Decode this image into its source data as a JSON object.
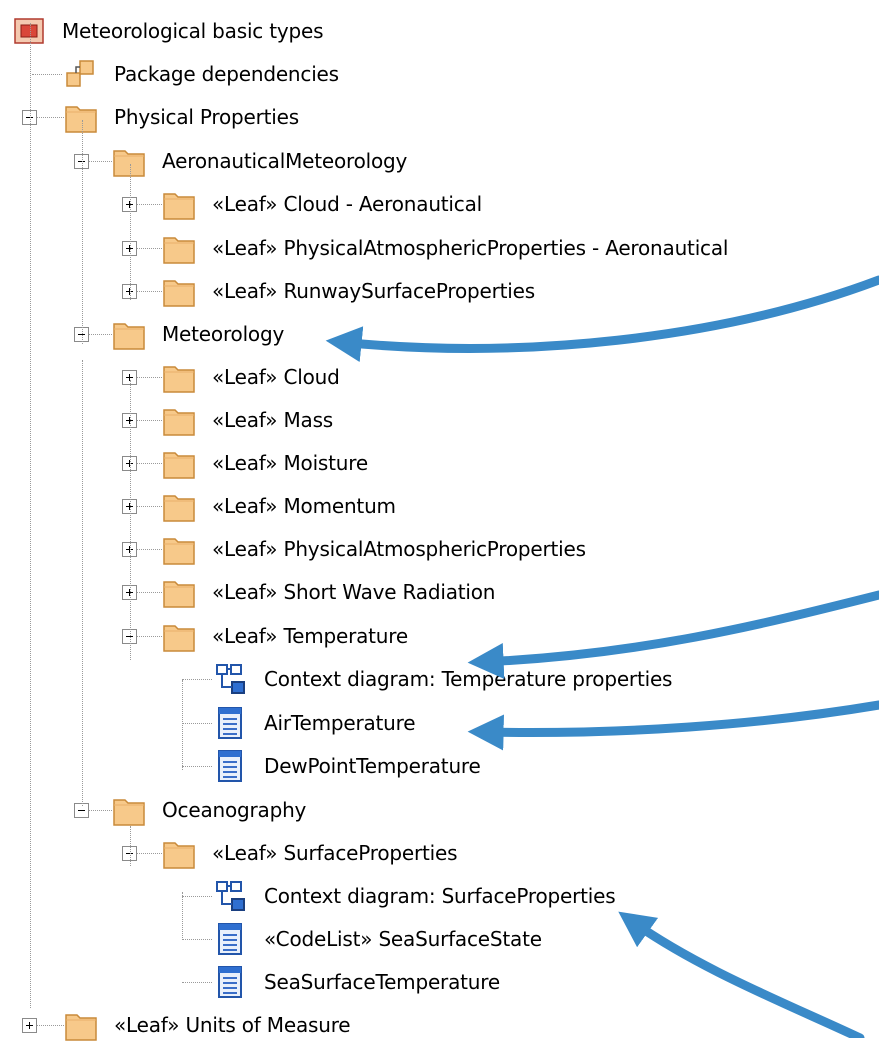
{
  "colors": {
    "folder_fill": "#f7c98a",
    "folder_edge": "#c98a3a",
    "arrow": "#3a8ac8"
  },
  "tree": [
    {
      "label": "Meteorological basic types",
      "icon": "model-icon",
      "expander": "none"
    },
    {
      "label": "Package dependencies",
      "icon": "package-dependencies-icon",
      "expander": "none"
    },
    {
      "label": "Physical Properties",
      "icon": "folder-icon",
      "expander": "minus"
    },
    {
      "label": "AeronauticalMeteorology",
      "icon": "folder-icon",
      "expander": "minus"
    },
    {
      "label": "«Leaf» Cloud - Aeronautical",
      "icon": "folder-icon",
      "expander": "plus"
    },
    {
      "label": "«Leaf» PhysicalAtmosphericProperties - Aeronautical",
      "icon": "folder-icon",
      "expander": "plus"
    },
    {
      "label": "«Leaf» RunwaySurfaceProperties",
      "icon": "folder-icon",
      "expander": "plus"
    },
    {
      "label": "Meteorology",
      "icon": "folder-icon",
      "expander": "minus"
    },
    {
      "label": "«Leaf» Cloud",
      "icon": "folder-icon",
      "expander": "plus"
    },
    {
      "label": "«Leaf» Mass",
      "icon": "folder-icon",
      "expander": "plus"
    },
    {
      "label": "«Leaf» Moisture",
      "icon": "folder-icon",
      "expander": "plus"
    },
    {
      "label": "«Leaf» Momentum",
      "icon": "folder-icon",
      "expander": "plus"
    },
    {
      "label": "«Leaf» PhysicalAtmosphericProperties",
      "icon": "folder-icon",
      "expander": "plus"
    },
    {
      "label": "«Leaf» Short Wave Radiation",
      "icon": "folder-icon",
      "expander": "plus"
    },
    {
      "label": "«Leaf» Temperature",
      "icon": "folder-icon",
      "expander": "minus"
    },
    {
      "label": "Context diagram: Temperature properties",
      "icon": "diagram-icon",
      "expander": "none"
    },
    {
      "label": "AirTemperature",
      "icon": "class-icon",
      "expander": "none"
    },
    {
      "label": "DewPointTemperature",
      "icon": "class-icon",
      "expander": "none"
    },
    {
      "label": "Oceanography",
      "icon": "folder-icon",
      "expander": "minus"
    },
    {
      "label": "«Leaf» SurfaceProperties",
      "icon": "folder-icon",
      "expander": "minus"
    },
    {
      "label": "Context diagram: SurfaceProperties",
      "icon": "diagram-icon",
      "expander": "none"
    },
    {
      "label": "«CodeList» SeaSurfaceState",
      "icon": "class-icon",
      "expander": "none"
    },
    {
      "label": "SeaSurfaceTemperature",
      "icon": "class-icon",
      "expander": "none"
    },
    {
      "label": "«Leaf» Units of Measure",
      "icon": "folder-icon",
      "expander": "plus"
    }
  ]
}
